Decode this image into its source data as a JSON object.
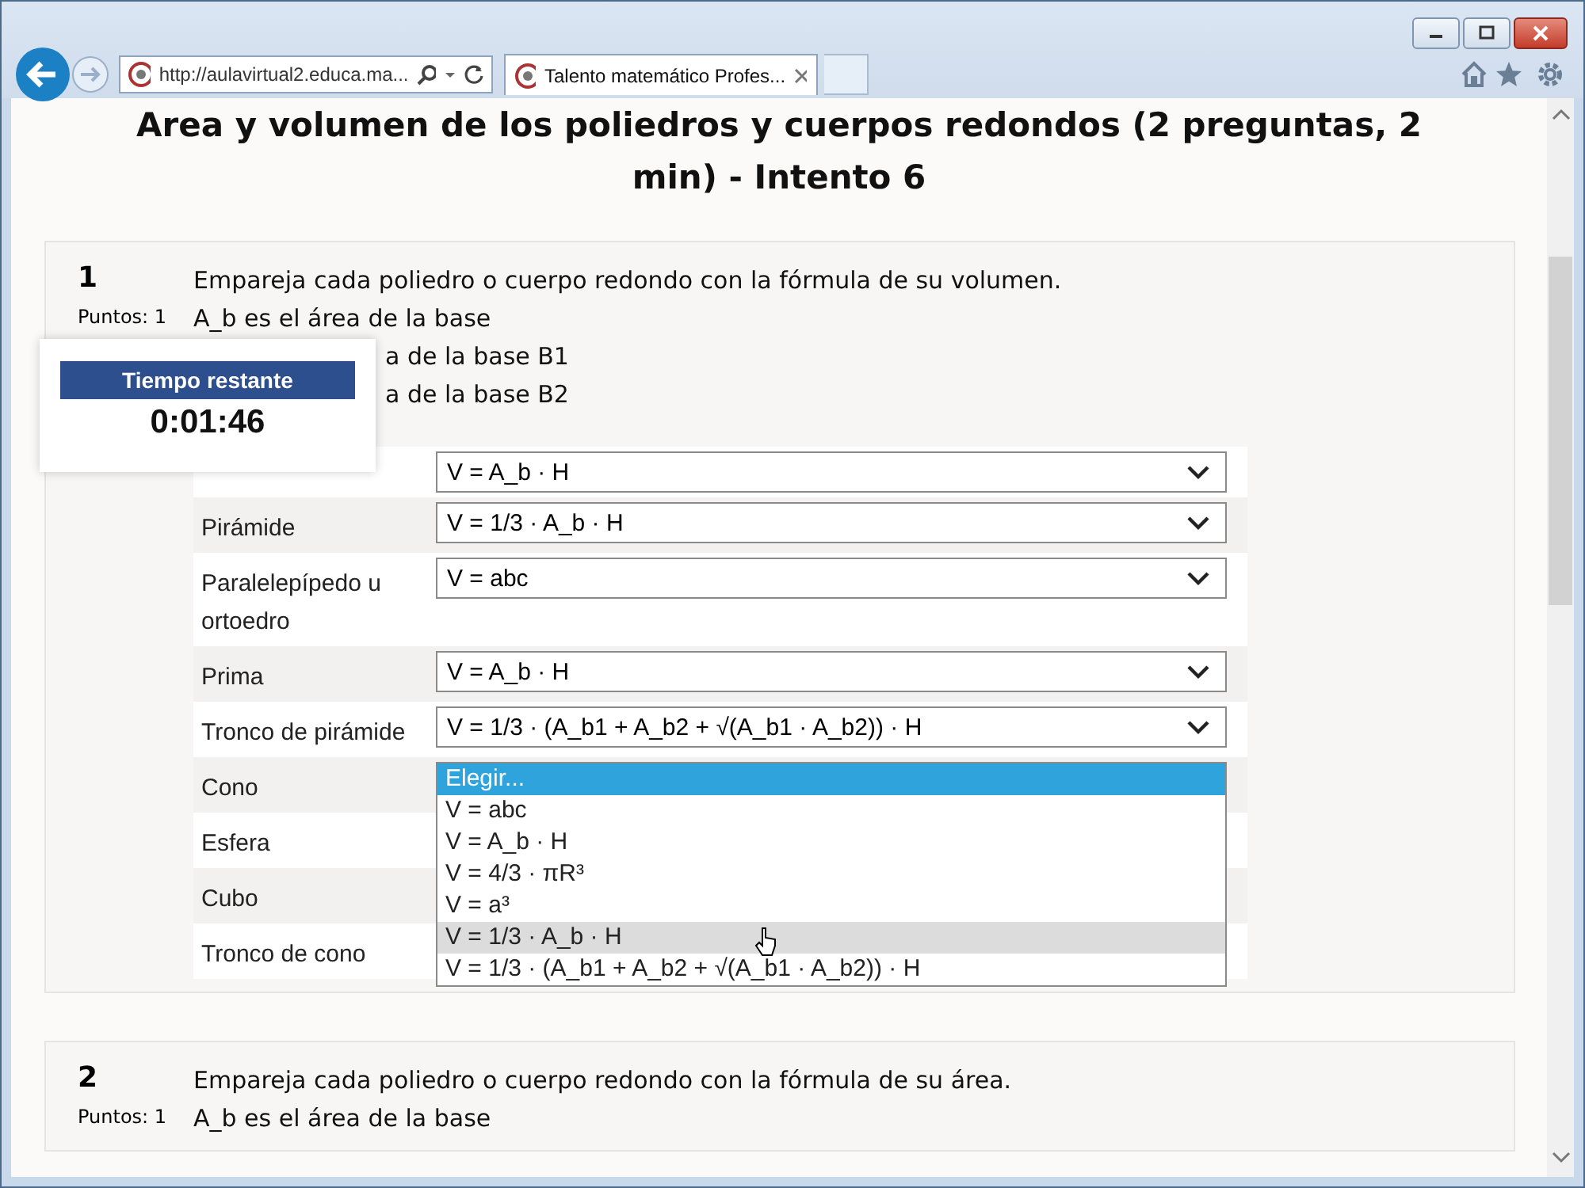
{
  "browser": {
    "address": "http://aulavirtual2.educa.ma...",
    "tab_title": "Talento matemático Profes..."
  },
  "page_title": "Area y volumen de los poliedros y cuerpos redondos (2 preguntas, 2 min) - Intento 6",
  "timer": {
    "heading": "Tiempo restante",
    "time": "0:01:46"
  },
  "questions": [
    {
      "number": "1",
      "points": "Puntos: 1",
      "lines": [
        {
          "text": "Empareja cada poliedro o cuerpo redondo con la fórmula de su volumen.",
          "kind": "full"
        },
        {
          "text": "A_b es el área de la base",
          "kind": "full"
        },
        {
          "text": "a de la base B1",
          "kind": "partial"
        },
        {
          "text": "a de la base B2",
          "kind": "partial"
        }
      ],
      "rows": [
        {
          "kind": "select",
          "value": "V = A_b · H"
        },
        {
          "kind": "select",
          "label": "Pirámide",
          "value": "V = 1/3 · A_b · H"
        },
        {
          "kind": "select",
          "label": "Paralelepípedo u ortoedro",
          "value": "V = abc"
        },
        {
          "kind": "select",
          "label": "Prima",
          "value": "V = A_b · H"
        },
        {
          "kind": "select",
          "label": "Tronco de pirámide",
          "value": "V = 1/3 · (A_b1 + A_b2 + √(A_b1 · A_b2)) · H"
        },
        {
          "kind": "open",
          "label": "Cono",
          "options": [
            {
              "text": "Elegir...",
              "selected": true,
              "hovered": false
            },
            {
              "text": "V = abc",
              "selected": false,
              "hovered": false
            },
            {
              "text": "V = A_b · H",
              "selected": false,
              "hovered": false
            },
            {
              "text": "V = 4/3 · πR³",
              "selected": false,
              "hovered": false
            },
            {
              "text": "V = a³",
              "selected": false,
              "hovered": false
            },
            {
              "text": "V = 1/3 · A_b · H",
              "selected": false,
              "hovered": true
            },
            {
              "text": "V = 1/3 · (A_b1 + A_b2 + √(A_b1 · A_b2)) · H",
              "selected": false,
              "hovered": false
            }
          ]
        },
        {
          "kind": "label_only",
          "label": "Esfera"
        },
        {
          "kind": "label_only",
          "label": "Cubo"
        },
        {
          "kind": "label_only",
          "label": "Tronco de cono"
        }
      ]
    },
    {
      "number": "2",
      "points": "Puntos: 1",
      "lines": [
        {
          "text": "Empareja cada poliedro o cuerpo redondo con la fórmula de su área.",
          "kind": "full"
        },
        {
          "text": "A_b es el área de la base",
          "kind": "full"
        }
      ]
    }
  ]
}
